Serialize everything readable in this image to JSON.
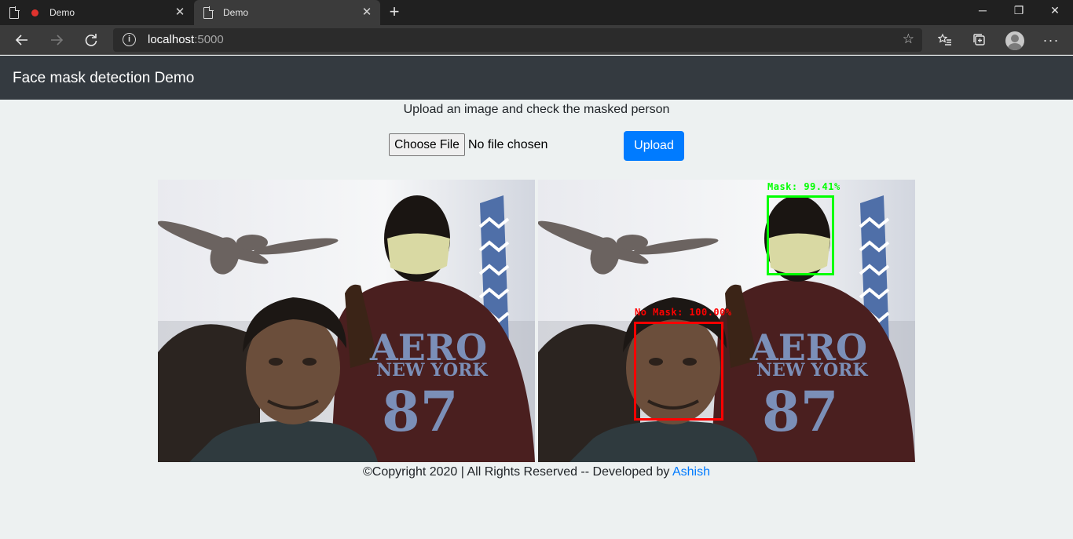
{
  "browser": {
    "tabs": [
      {
        "title": "Demo",
        "recording": true,
        "active": false
      },
      {
        "title": "Demo",
        "recording": false,
        "active": true
      }
    ],
    "address": {
      "host": "localhost",
      "port": ":5000"
    }
  },
  "navbar": {
    "brand": "Face mask detection Demo"
  },
  "upload": {
    "instructions": "Upload an image and check the masked person",
    "choose_file_label": "Choose File",
    "file_status": "No file chosen",
    "upload_label": "Upload"
  },
  "images": {
    "input": {
      "alt": "Uploaded photo"
    },
    "output": {
      "alt": "Detection result",
      "detections": [
        {
          "label": "Mask: 99.41%",
          "color": "#00ff00"
        },
        {
          "label": "No Mask: 100.00%",
          "color": "#ff0000"
        }
      ]
    }
  },
  "footer": {
    "copyright": "©Copyright 2020 | All Rights Reserved -- Developed by ",
    "author_link": "Ashish"
  },
  "colors": {
    "navbar": "#343a40",
    "primary": "#007bff",
    "page_bg": "#edf1f1"
  }
}
